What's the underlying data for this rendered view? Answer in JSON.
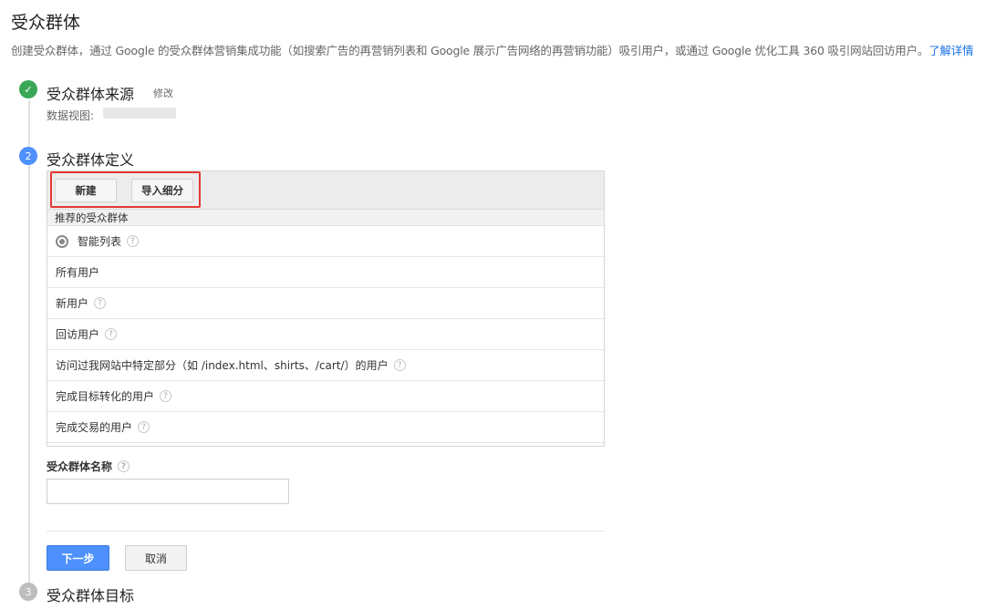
{
  "page": {
    "title": "受众群体",
    "description": "创建受众群体，通过 Google 的受众群体营销集成功能（如搜索广告的再营销列表和 Google 展示广告网络的再营销功能）吸引用户，或通过 Google 优化工具 360 吸引网站回访用户。",
    "learn_more": "了解详情"
  },
  "step1": {
    "number": "✓",
    "title": "受众群体来源",
    "edit": "修改",
    "view_label": "数据视图:"
  },
  "step2": {
    "number": "2",
    "title": "受众群体定义",
    "toolbar": {
      "new_label": "新建",
      "import_label": "导入细分"
    },
    "section_header": "推荐的受众群体",
    "items": [
      {
        "label": "智能列表"
      },
      {
        "label": "所有用户"
      },
      {
        "label": "新用户"
      },
      {
        "label": "回访用户"
      },
      {
        "label": "访问过我网站中特定部分（如 /index.html、shirts、/cart/）的用户"
      },
      {
        "label": "完成目标转化的用户"
      },
      {
        "label": "完成交易的用户"
      }
    ],
    "name_label": "受众群体名称",
    "name_value": "",
    "next_label": "下一步",
    "cancel_label": "取消"
  },
  "step3": {
    "number": "3",
    "title": "受众群体目标"
  },
  "help_glyph": "?",
  "colors": {
    "accent": "#4d90fe",
    "success": "#3aa757",
    "highlight": "#e53935",
    "link": "#1a73e8"
  }
}
